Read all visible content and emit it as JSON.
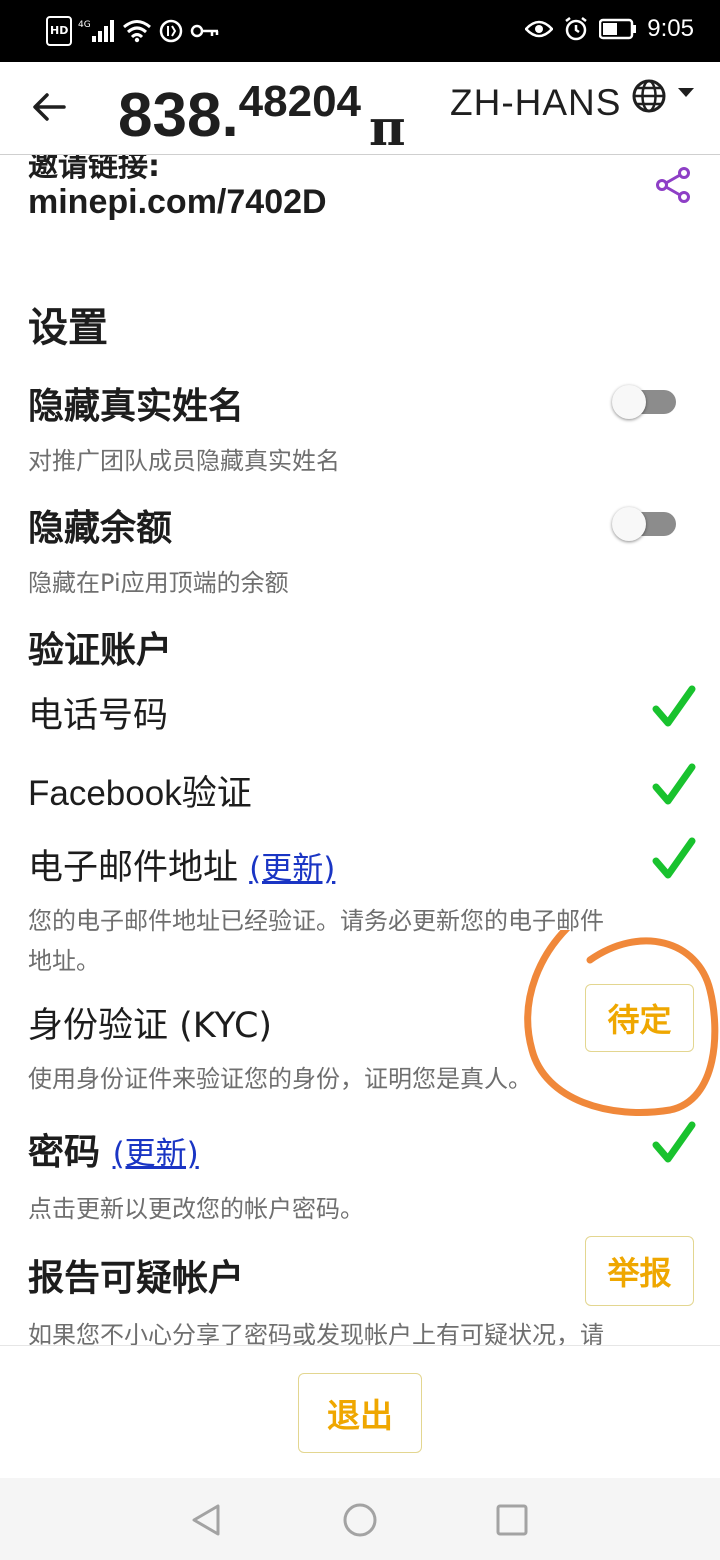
{
  "status_bar": {
    "hd_badge": "HD",
    "network": "4G",
    "time": "9:05"
  },
  "header": {
    "balance_integer": "838.",
    "balance_decimal": "48204",
    "currency_symbol": "π",
    "language": "ZH-HANS"
  },
  "invite": {
    "label_partial": "邀请链接:",
    "link": "minepi.com/7402D"
  },
  "settings": {
    "heading": "设置",
    "hide_name": {
      "title": "隐藏真实姓名",
      "description": "对推广团队成员隐藏真实姓名",
      "enabled": false
    },
    "hide_balance": {
      "title": "隐藏余额",
      "description": "隐藏在Pi应用顶端的余额",
      "enabled": false
    }
  },
  "verify": {
    "heading": "验证账户",
    "phone": {
      "label": "电话号码",
      "status": "verified"
    },
    "facebook": {
      "label": "Facebook验证",
      "status": "verified"
    },
    "email": {
      "label": "电子邮件地址",
      "update_link": "(更新)",
      "description_line1": "您的电子邮件地址已经验证。请务必更新您的电子邮件",
      "description_line2": "地址。",
      "status": "verified"
    },
    "kyc": {
      "label": "身份验证 (KYC)",
      "button": "待定",
      "description": "使用身份证件来验证您的身份，证明您是真人。"
    },
    "password": {
      "label": "密码",
      "update_link": "(更新)",
      "description": "点击更新以更改您的帐户密码。",
      "status": "verified"
    },
    "report": {
      "label": "报告可疑帐户",
      "button": "举报",
      "description": "如果您不小心分享了密码或发现帐户上有可疑状况，请"
    }
  },
  "footer": {
    "logout": "退出"
  },
  "colors": {
    "check_green": "#19c22e",
    "accent_orange": "#efa700",
    "link_blue": "#1a35c4",
    "share_purple": "#8e3fc6",
    "annotation_orange": "#f0883a"
  }
}
